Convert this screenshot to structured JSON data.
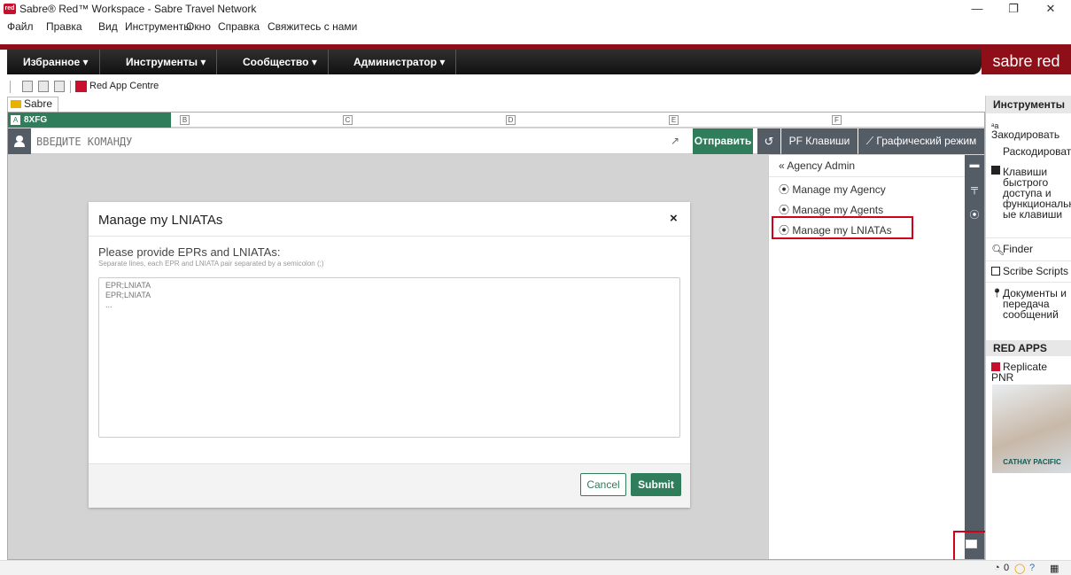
{
  "window": {
    "title": "Sabre® Red™ Workspace - Sabre Travel Network",
    "logo_text": "red",
    "minimize": "—",
    "maximize": "❐",
    "close": "✕"
  },
  "menu": {
    "file": "Файл",
    "edit": "Правка",
    "view": "Вид",
    "tools": "Инструменты",
    "window": "Окно",
    "help": "Справка",
    "contact": "Свяжитесь с нами"
  },
  "nav": {
    "favorites": "Избранное ▾",
    "tools": "Инструменты ▾",
    "community": "Сообщество ▾",
    "admin": "Администратор ▾",
    "brand": "sabre red"
  },
  "toolbar": {
    "red_app_centre": "Red App Centre"
  },
  "workspace": {
    "tab_label": "Sabre",
    "areas": [
      {
        "letter": "A",
        "text": "8XFG"
      },
      {
        "letter": "B",
        "text": ""
      },
      {
        "letter": "C",
        "text": ""
      },
      {
        "letter": "D",
        "text": ""
      },
      {
        "letter": "E",
        "text": ""
      },
      {
        "letter": "F",
        "text": ""
      }
    ],
    "command_placeholder": "ВВЕДИТЕ КОМАНДУ",
    "send": "Отправить",
    "history_icon": "↺",
    "pf_keys": "PF Клавиши",
    "graphic_mode": "⟋ Графический режим"
  },
  "agency_panel": {
    "back": "« Agency Admin",
    "items": [
      "Manage my Agency",
      "Manage my Agents",
      "Manage my LNIATAs"
    ],
    "bullet": "⦿"
  },
  "modal": {
    "title": "Manage my LNIATAs",
    "close": "×",
    "prompt": "Please provide EPRs and LNIATAs:",
    "hint": "Separate lines, each EPR and LNIATA pair separated by a semicolon (;)",
    "placeholder": "EPR;LNIATA\nEPR;LNIATA\n...",
    "cancel": "Cancel",
    "submit": "Submit"
  },
  "sidebar": {
    "header": "Инструменты",
    "encode": "Закодировать",
    "decode": "Раскодировать",
    "hotkeys": [
      "Клавиши",
      "быстрого",
      "доступа и",
      "функциональн",
      "ые клавиши"
    ],
    "finder": "Finder",
    "scribe": "Scribe Scripts",
    "docs": [
      "Документы и",
      "передача",
      "сообщений"
    ],
    "red_apps": "RED APPS",
    "replicate": "Replicate PNR",
    "ad_text": "CATHAY PACIFIC"
  },
  "status": {
    "count": "0"
  },
  "colors": {
    "accent": "#2f7d5b",
    "brand_red": "#8e0f17",
    "highlight": "#d0021b",
    "slate": "#545d66"
  }
}
